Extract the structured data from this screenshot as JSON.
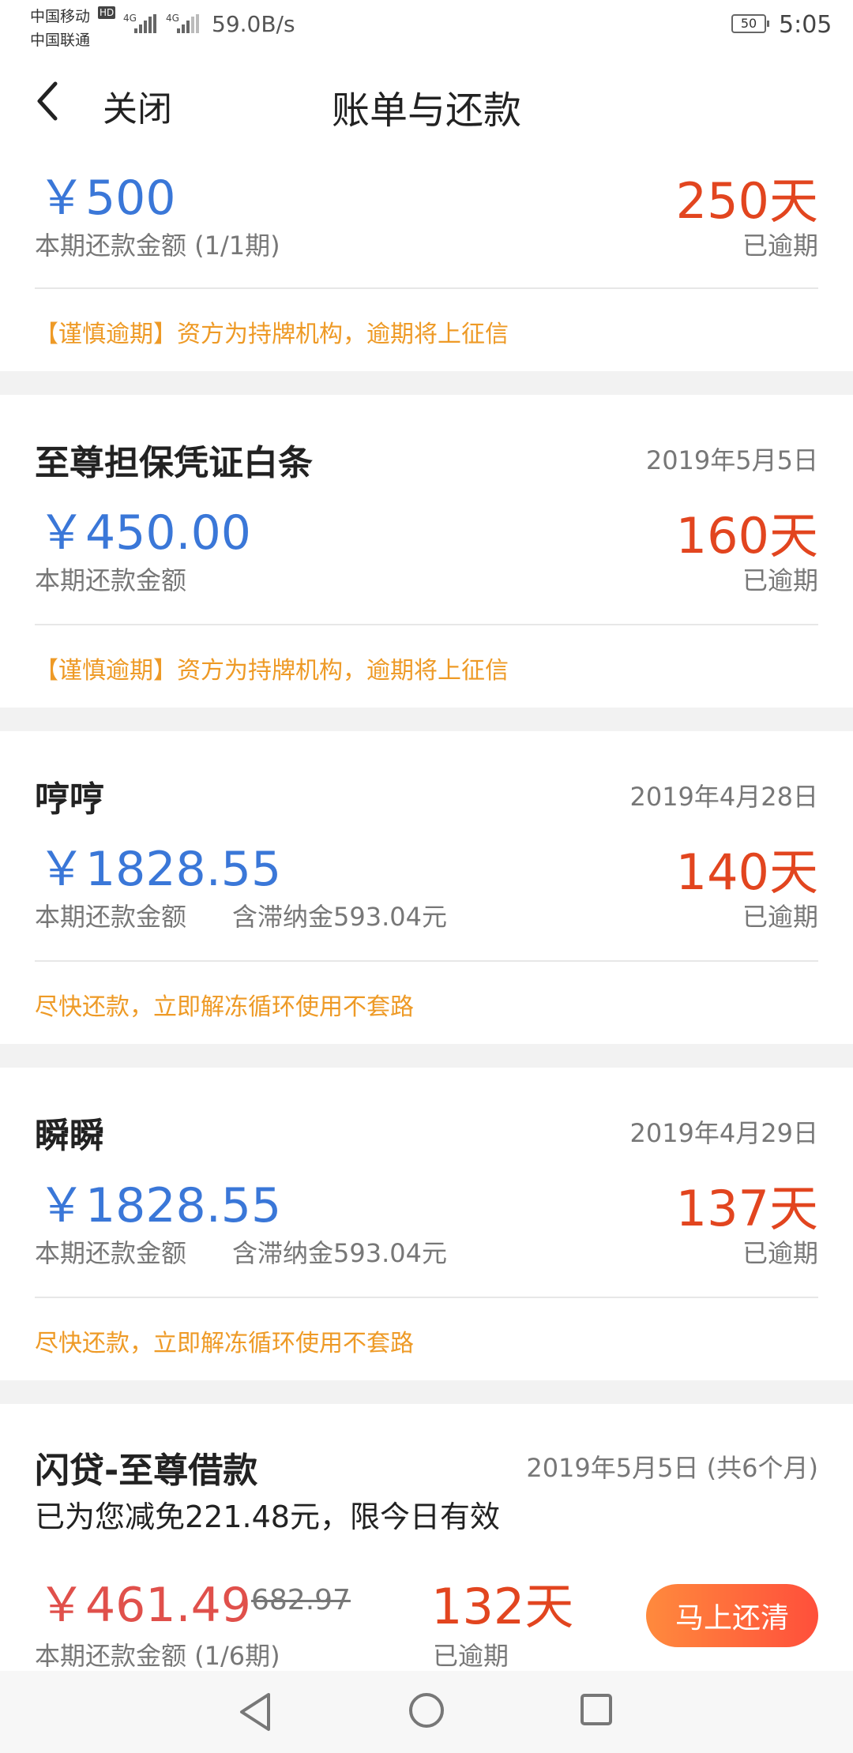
{
  "status_bar": {
    "carrier_1": "中国移动",
    "carrier_2": "中国联通",
    "hd": "HD",
    "signal_1": "4G",
    "signal_2": "4G",
    "net_speed": "59.0B/s",
    "battery": "50",
    "time": "5:05"
  },
  "nav": {
    "close_label": "关闭",
    "title": "账单与还款"
  },
  "cards": [
    {
      "amount": "￥500",
      "days": "250天",
      "sub_label": "本期还款金额 (1/1期)",
      "overdue_label": "已逾期",
      "notice": "【谨慎逾期】资方为持牌机构，逾期将上征信"
    },
    {
      "name": "至尊担保凭证白条",
      "date": "2019年5月5日",
      "amount": "￥450.00",
      "days": "160天",
      "sub_label": "本期还款金额",
      "overdue_label": "已逾期",
      "notice": "【谨慎逾期】资方为持牌机构，逾期将上征信"
    },
    {
      "name": "哼哼",
      "date": "2019年4月28日",
      "amount": "￥1828.55",
      "days": "140天",
      "sub_label": "本期还款金额",
      "penalty": "含滞纳金593.04元",
      "overdue_label": "已逾期",
      "notice": "尽快还款，立即解冻循环使用不套路"
    },
    {
      "name": "瞬瞬",
      "date": "2019年4月29日",
      "amount": "￥1828.55",
      "days": "137天",
      "sub_label": "本期还款金额",
      "penalty": "含滞纳金593.04元",
      "overdue_label": "已逾期",
      "notice": "尽快还款，立即解冻循环使用不套路"
    },
    {
      "name": "闪贷-至尊借款",
      "date": "2019年5月5日 (共6个月)",
      "reduction": "已为您减免221.48元，限今日有效",
      "amount": "￥461.49",
      "original_amount": "682.97",
      "days": "132天",
      "sub_label": "本期还款金额 (1/6期)",
      "overdue_label": "已逾期",
      "button": "马上还清"
    }
  ],
  "icons": {
    "back": "chevron-left-icon",
    "nav_back": "triangle-back-icon",
    "nav_home": "circle-home-icon",
    "nav_recent": "square-recent-icon"
  },
  "colors": {
    "amount_blue": "#3a77d8",
    "overdue_red": "#e2451f",
    "notice_orange": "#ee9a26",
    "button_gradient_start": "#ff8a3d",
    "button_gradient_end": "#ff4f3b"
  }
}
